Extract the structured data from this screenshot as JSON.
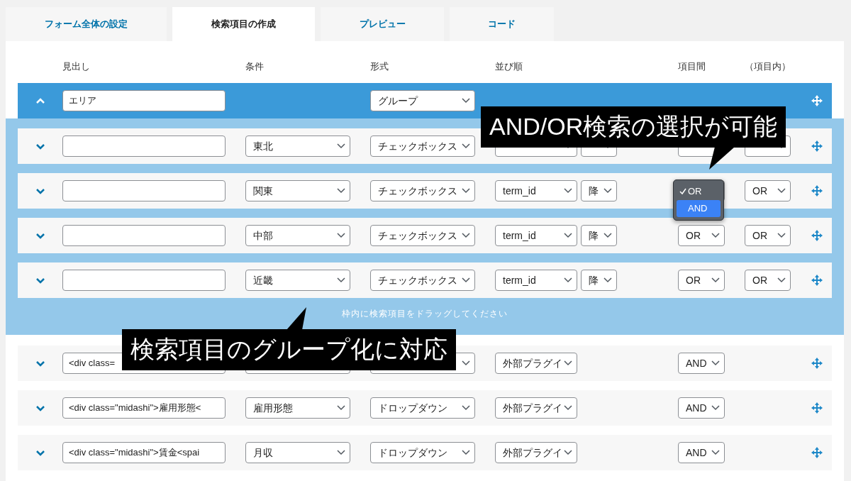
{
  "tabs": [
    {
      "label": "フォーム全体の設定",
      "selected": false
    },
    {
      "label": "検索項目の作成",
      "selected": true
    },
    {
      "label": "プレビュー",
      "selected": false
    },
    {
      "label": "コード",
      "selected": false
    }
  ],
  "columns": [
    "見出し",
    "条件",
    "形式",
    "並び順",
    "項目間",
    "（項目内）"
  ],
  "group": {
    "expanded": true,
    "heading": "エリア",
    "format": "グループ",
    "drop_hint": "枠内に検索項目をドラッグしてください",
    "items": [
      {
        "expanded": false,
        "condition": "東北",
        "format": "チェックボックス"
      },
      {
        "expanded": false,
        "condition": "関東",
        "format": "チェックボックス",
        "sort": "term_id",
        "order": "降",
        "within": "OR",
        "between_menu": {
          "options": [
            {
              "label": "OR",
              "checked": true,
              "highlighted": false
            },
            {
              "label": "AND",
              "checked": false,
              "highlighted": true
            }
          ]
        }
      },
      {
        "expanded": false,
        "condition": "中部",
        "format": "チェックボックス",
        "sort": "term_id",
        "order": "降",
        "between": "OR",
        "within": "OR"
      },
      {
        "expanded": false,
        "condition": "近畿",
        "format": "チェックボックス",
        "sort": "term_id",
        "order": "降",
        "between": "OR",
        "within": "OR"
      }
    ]
  },
  "rows": [
    {
      "expanded": false,
      "heading": "<div class=",
      "sort": "外部プラグイ",
      "between": "AND"
    },
    {
      "expanded": false,
      "heading": "<div class=\"midashi\">雇用形態<",
      "condition": "雇用形態",
      "format": "ドロップダウン",
      "sort": "外部プラグイ",
      "between": "AND"
    },
    {
      "expanded": false,
      "heading": "<div class=\"midashi\">賃金<spai",
      "condition": "月収",
      "format": "ドロップダウン",
      "sort": "外部プラグイ",
      "between": "AND"
    }
  ],
  "callouts": [
    {
      "text": "AND/OR検索の選択が可能"
    },
    {
      "text": "検索項目のグループ化に対応"
    }
  ]
}
